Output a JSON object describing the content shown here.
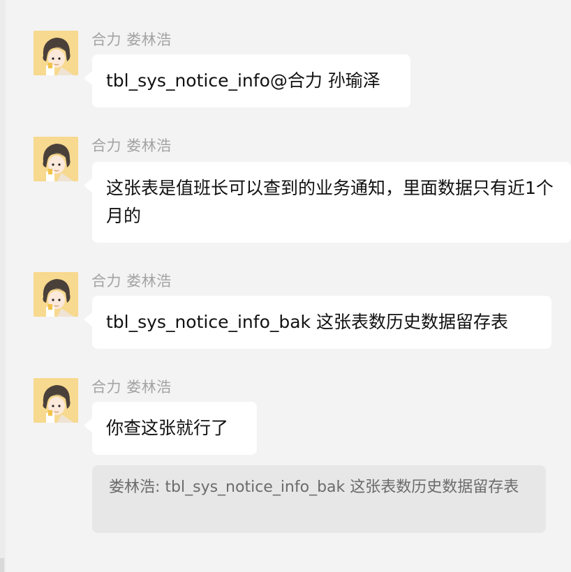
{
  "messages": [
    {
      "sender": "合力 娄林浩",
      "text": "tbl_sys_notice_info@合力 孙瑜泽"
    },
    {
      "sender": "合力 娄林浩",
      "text": "这张表是值班长可以查到的业务通知，里面数据只有近1个月的"
    },
    {
      "sender": "合力 娄林浩",
      "text": "tbl_sys_notice_info_bak 这张表数历史数据留存表"
    },
    {
      "sender": "合力 娄林浩",
      "text": "你查这张就行了"
    }
  ],
  "quote": {
    "text": "娄林浩: tbl_sys_notice_info_bak 这张表数历史数据留存表"
  },
  "colors": {
    "background": "#f3f3f3",
    "bubble": "#ffffff",
    "quote_bg": "#e7e7e7",
    "sender_text": "#a3a3a3",
    "avatar_bg": "#f7d98f"
  },
  "icons": {
    "avatar": "cartoon-person-avatar-icon"
  }
}
